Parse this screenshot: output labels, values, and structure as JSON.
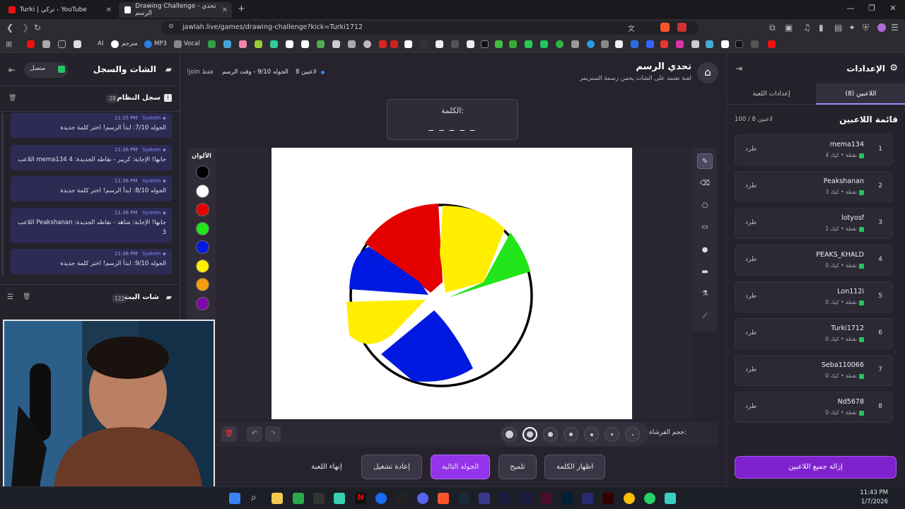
{
  "browser": {
    "tabs": [
      {
        "title": "Turki | تركي - YouTube"
      },
      {
        "title": "Drawing Challenge - تحدي الرسم"
      }
    ],
    "url": "jawlah.live/games/drawing-challenge?kick=Turki1712",
    "bookmarks": [
      "AI",
      "مترجم",
      "MP3",
      "Vocal"
    ]
  },
  "left_panel": {
    "title": "الشات والسجل",
    "status": "متصل",
    "system_log": {
      "title": "سجل النظام",
      "count": "28"
    },
    "messages": [
      {
        "time": "11:35 PM",
        "sender": "System",
        "text": "الجوله 7/10: ابدأ الرسم! اختر كلمة جديدة"
      },
      {
        "time": "11:36 PM",
        "sender": "System",
        "text": "اللاعب mema134 جابها! الإجابة: كريبر - نقاطه الجديدة: 4"
      },
      {
        "time": "11:36 PM",
        "sender": "System",
        "text": "الجوله 8/10: ابدأ الرسم! اختر كلمة جديدة"
      },
      {
        "time": "11:38 PM",
        "sender": "System",
        "text": "اللاعب Peakshanan جابها! الإجابة: شاهد - نقاطه الجديدة: 3"
      },
      {
        "time": "11:38 PM",
        "sender": "System",
        "text": "الجوله 9/10: ابدأ الرسم! اختر كلمة جديدة"
      }
    ],
    "live_chat": {
      "title": "شات البث",
      "count": "122"
    }
  },
  "header": {
    "title": "تحدي الرسم",
    "subtitle": "لعبة تعتمد على الشات يخمن رسمة الستريمر",
    "players_count": "8 لاعبين",
    "round": "الجوله 9/10 - وقت الرسم",
    "join_hint": "!join فقط"
  },
  "word": {
    "label": "الكلمة:",
    "mask": "_ _ _ _ _"
  },
  "colors": {
    "label": "الألوان",
    "swatches": [
      "#000000",
      "#ffffff",
      "#e50000",
      "#22e51a",
      "#0019e0",
      "#ffee00",
      "#f59e0b",
      "#7e0aa6"
    ]
  },
  "brush": {
    "label": "حجم الفرشاة:",
    "selected_index": 1
  },
  "actions": {
    "show_word": "اظهار الكلمة",
    "hint": "تلميح",
    "next_round": "الجوله التالية",
    "restart": "إعادة تشغيل",
    "end_game": "إنهاء اللعبة"
  },
  "right_panel": {
    "title": "الإعدادات",
    "tab_players": "اللاعبين (8)",
    "tab_settings": "إعدادات اللعبة",
    "list_title": "قائمة اللاعبين",
    "capacity": "100 / 8 لاعبين",
    "kick_label": "طرد",
    "players": [
      {
        "rank": "1",
        "name": "mema134",
        "points": "4 نقطة",
        "platform": "كيك"
      },
      {
        "rank": "2",
        "name": "Peakshanan",
        "points": "3 نقطة",
        "platform": "كيك"
      },
      {
        "rank": "3",
        "name": "lotyosf",
        "points": "1 نقطة",
        "platform": "كيك"
      },
      {
        "rank": "4",
        "name": "PEAKS_KHALD",
        "points": "0 نقطة",
        "platform": "كيك"
      },
      {
        "rank": "5",
        "name": "Lon112i",
        "points": "0 نقطة",
        "platform": "كيك"
      },
      {
        "rank": "6",
        "name": "Turki1712",
        "points": "0 نقطة",
        "platform": "كيك"
      },
      {
        "rank": "7",
        "name": "Seba110066",
        "points": "0 نقطة",
        "platform": "كيك"
      },
      {
        "rank": "8",
        "name": "Nd5678",
        "points": "0 نقطة",
        "platform": "كيك"
      }
    ],
    "remove_all": "إزالة جميع اللاعبين"
  },
  "taskbar": {
    "time": "11:43 PM",
    "date": "1/7/2026"
  }
}
